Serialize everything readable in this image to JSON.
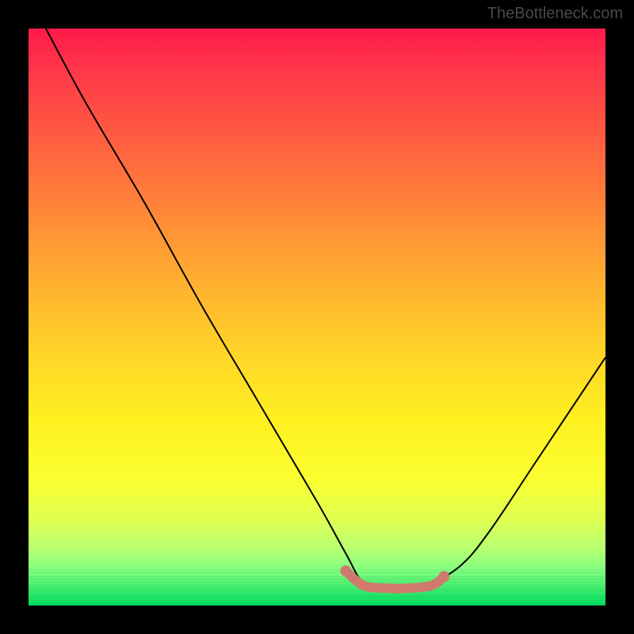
{
  "watermark": "TheBottleneck.com",
  "chart_data": {
    "type": "line",
    "title": "",
    "xlabel": "",
    "ylabel": "",
    "xlim": [
      0,
      100
    ],
    "ylim": [
      0,
      100
    ],
    "series": [
      {
        "name": "bottleneck-curve",
        "x": [
          3,
          10,
          20,
          30,
          40,
          50,
          55,
          58,
          62,
          66,
          70,
          75,
          80,
          88,
          100
        ],
        "y": [
          100,
          87,
          70,
          52,
          35,
          18,
          9,
          4,
          3,
          3,
          4,
          7,
          13,
          25,
          43
        ],
        "color": "#000000"
      },
      {
        "name": "optimal-zone",
        "x": [
          55,
          58,
          62,
          66,
          70,
          72
        ],
        "y": [
          6,
          3.5,
          3,
          3,
          3.5,
          5
        ],
        "color": "#d07a6e"
      }
    ],
    "gradient_stops": [
      {
        "pos": 0,
        "color": "#ff1a4a"
      },
      {
        "pos": 50,
        "color": "#ffd030"
      },
      {
        "pos": 100,
        "color": "#00e060"
      }
    ]
  }
}
